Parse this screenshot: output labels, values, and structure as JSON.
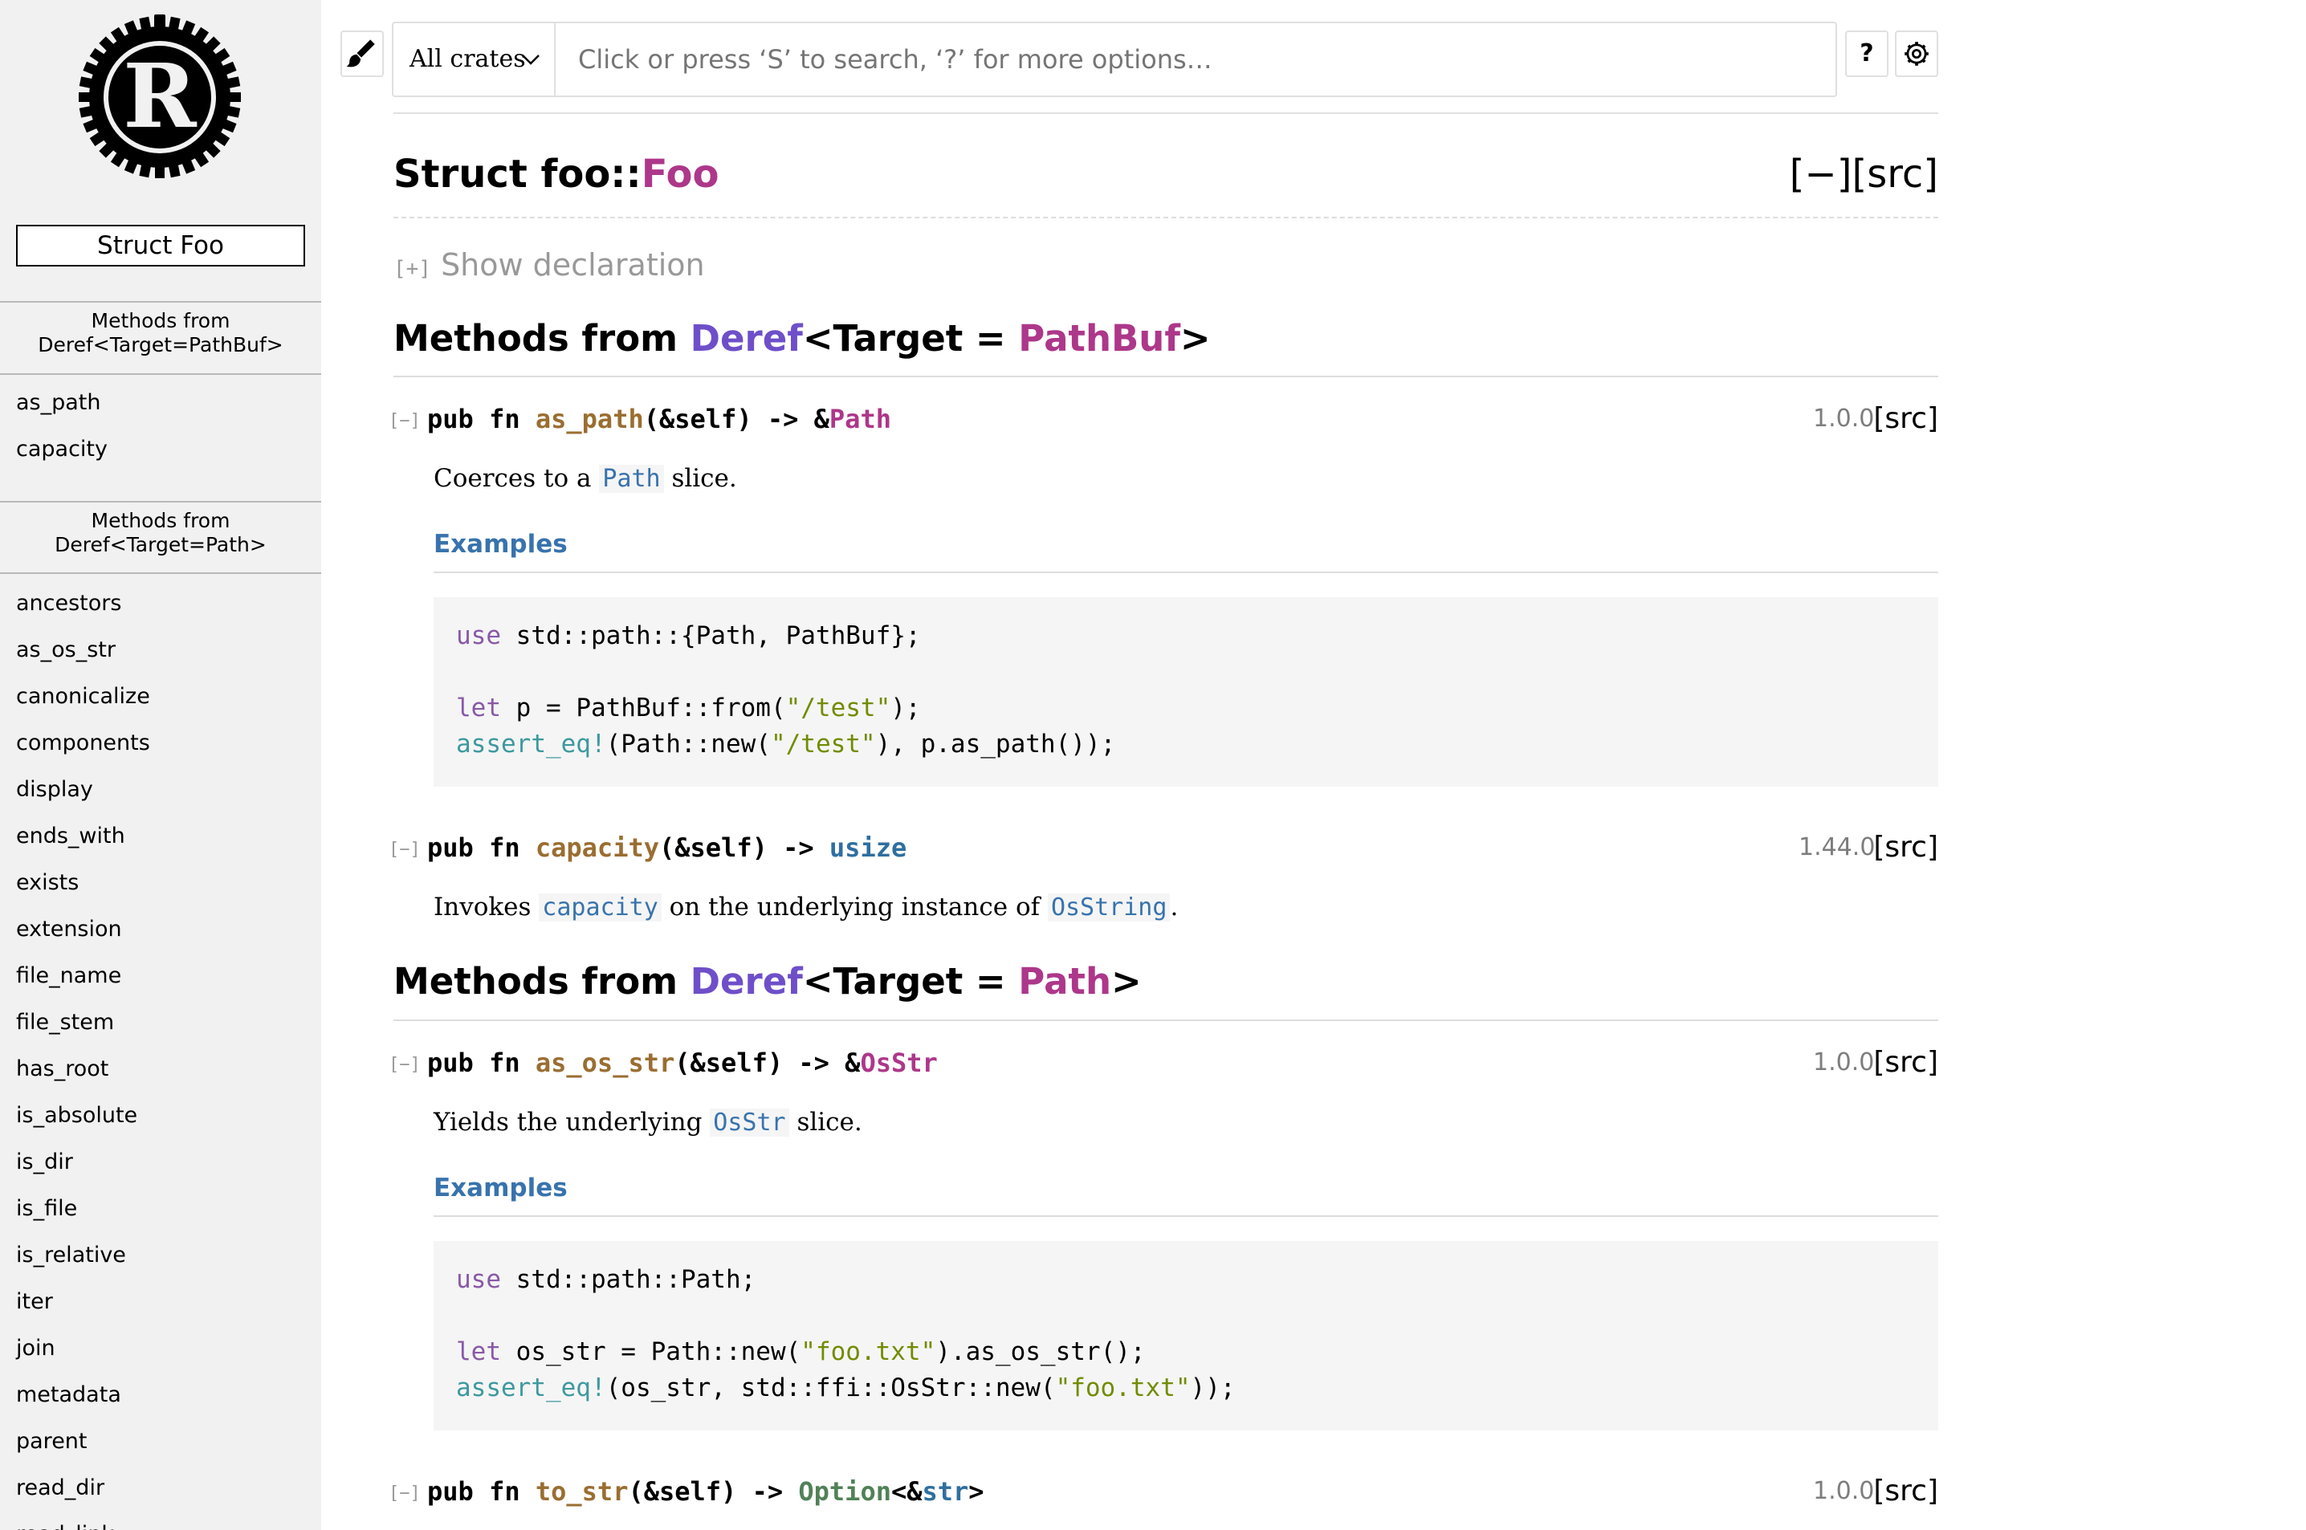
{
  "sidebar": {
    "title": "Struct Foo",
    "sections": [
      {
        "heading_lines": [
          "Methods from",
          "Deref<Target=PathBuf>"
        ],
        "items": [
          "as_path",
          "capacity"
        ]
      },
      {
        "heading_lines": [
          "Methods from",
          "Deref<Target=Path>"
        ],
        "items": [
          "ancestors",
          "as_os_str",
          "canonicalize",
          "components",
          "display",
          "ends_with",
          "exists",
          "extension",
          "file_name",
          "file_stem",
          "has_root",
          "is_absolute",
          "is_dir",
          "is_file",
          "is_relative",
          "iter",
          "join",
          "metadata",
          "parent",
          "read_dir",
          "read_link"
        ]
      }
    ]
  },
  "search": {
    "crate_filter": "All crates",
    "placeholder": "Click or press ‘S’ to search, ‘?’ for more options…",
    "help_label": "?"
  },
  "header": {
    "kind_prefix": "Struct foo::",
    "name": "Foo",
    "controls": "[−][src]",
    "show_declaration_bracket": "[+]",
    "show_declaration": "Show declaration"
  },
  "sections": [
    {
      "prefix": "Methods from ",
      "trait": "Deref",
      "middle": "<Target = ",
      "target": "PathBuf",
      "suffix": ">"
    },
    {
      "prefix": "Methods from ",
      "trait": "Deref",
      "middle": "<Target = ",
      "target": "Path",
      "suffix": ">"
    }
  ],
  "methods": {
    "toggle_label": "[−]",
    "src_label": "[src]",
    "examples_label": "Examples",
    "as_path": {
      "pre": "pub fn ",
      "name": "as_path",
      "args": "(&self) -> &",
      "ret": "Path",
      "post": "",
      "since": "1.0.0",
      "doc_pre": "Coerces to a ",
      "doc_code": "Path",
      "doc_post": " slice.",
      "code": {
        "l1_kw": "use",
        "l1_rest": " std::path::{Path, PathBuf};",
        "l3_kw": "let",
        "l3_a": " p = PathBuf::from(",
        "l3_str": "\"/test\"",
        "l3_b": ");",
        "l4_mac": "assert_eq!",
        "l4_a": "(Path::new(",
        "l4_str": "\"/test\"",
        "l4_b": "), p.as_path());"
      }
    },
    "capacity": {
      "pre": "pub fn ",
      "name": "capacity",
      "args": "(&self) -> ",
      "ret": "usize",
      "since": "1.44.0",
      "doc_pre": "Invokes ",
      "doc_code1": "capacity",
      "doc_mid": " on the underlying instance of ",
      "doc_code2": "OsString",
      "doc_post": "."
    },
    "as_os_str": {
      "pre": "pub fn ",
      "name": "as_os_str",
      "args": "(&self) -> &",
      "ret": "OsStr",
      "since": "1.0.0",
      "doc_pre": "Yields the underlying ",
      "doc_code": "OsStr",
      "doc_post": " slice.",
      "code": {
        "l1_kw": "use",
        "l1_rest": " std::path::Path;",
        "l3_kw": "let",
        "l3_a": " os_str = Path::new(",
        "l3_str": "\"foo.txt\"",
        "l3_b": ").as_os_str();",
        "l4_mac": "assert_eq!",
        "l4_a": "(os_str, std::ffi::OsStr::new(",
        "l4_str": "\"foo.txt\"",
        "l4_b": "));"
      }
    },
    "to_str": {
      "pre": "pub fn ",
      "name": "to_str",
      "args": "(&self) -> ",
      "ret1": "Option",
      "mid": "<&",
      "ret2": "str",
      "post": ">",
      "since": "1.0.0"
    }
  },
  "colors": {
    "sidebar_bg": "#f1f1f1",
    "struct": "#ad378a",
    "trait": "#6e4fc9",
    "fn": "#9a6e31",
    "link": "#3873ad"
  }
}
